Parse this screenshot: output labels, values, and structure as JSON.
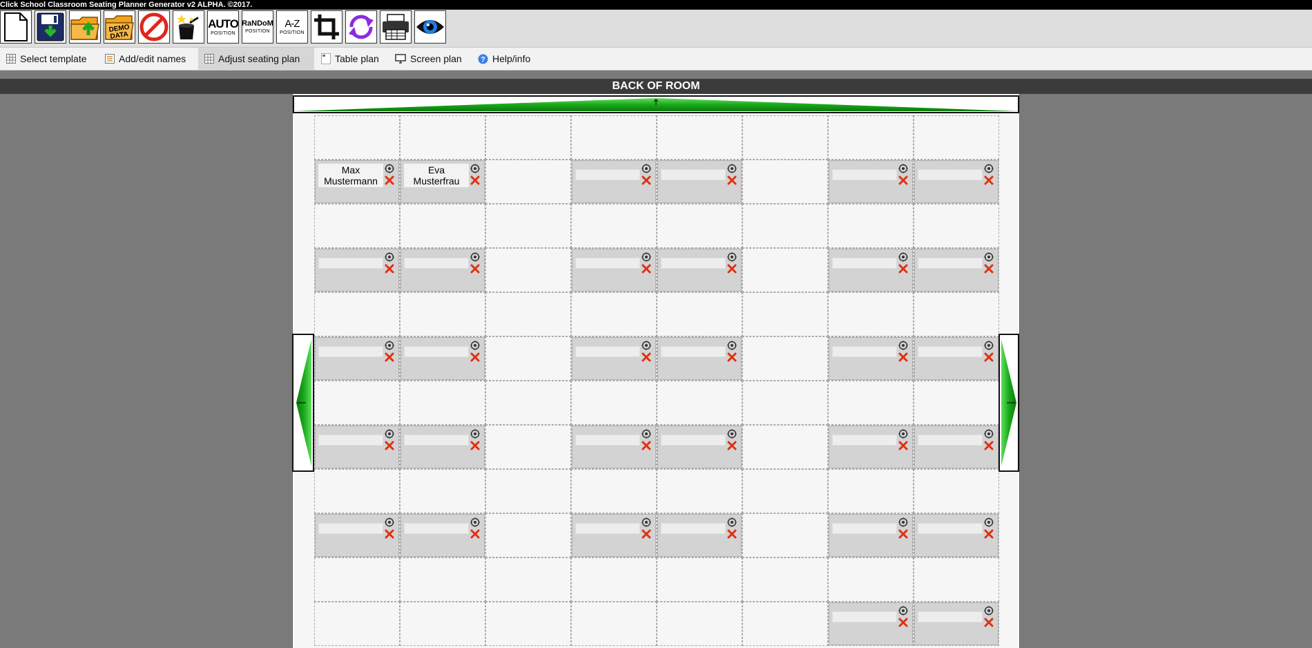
{
  "window": {
    "title": "Click School Classroom Seating Planner Generator v2 ALPHA. ©2017."
  },
  "toolbar": {
    "buttons": [
      {
        "id": "new",
        "icon": "new-document-icon"
      },
      {
        "id": "save",
        "icon": "save-disk-icon"
      },
      {
        "id": "open",
        "icon": "open-folder-icon"
      },
      {
        "id": "demo",
        "icon": "demo-data-folder-icon",
        "label": "DEMO DATA"
      },
      {
        "id": "clear",
        "icon": "no-entry-icon"
      },
      {
        "id": "magic",
        "icon": "magic-wand-icon"
      },
      {
        "id": "auto",
        "label_big": "AUTO",
        "label_small": "POSITION"
      },
      {
        "id": "random",
        "label_big": "RaNDoM",
        "label_small": "POSITION"
      },
      {
        "id": "az",
        "label_big": "A-Z",
        "label_small": "POSITION"
      },
      {
        "id": "crop",
        "icon": "crop-icon"
      },
      {
        "id": "refresh",
        "icon": "refresh-icon"
      },
      {
        "id": "print",
        "icon": "printer-icon"
      },
      {
        "id": "view",
        "icon": "eye-icon"
      }
    ]
  },
  "tabs": [
    {
      "label": "Select template",
      "icon": "grid-icon"
    },
    {
      "label": "Add/edit names",
      "icon": "list-icon"
    },
    {
      "label": "Adjust seating plan",
      "icon": "grid-icon",
      "active": true
    },
    {
      "label": "Table plan",
      "icon": "table-plan-icon"
    },
    {
      "label": "Screen plan",
      "icon": "monitor-icon"
    },
    {
      "label": "Help/info",
      "icon": "help-icon"
    }
  ],
  "room": {
    "back_label": "BACK OF ROOM"
  },
  "desks": [
    {
      "row": 1,
      "col": 0,
      "name": "Max Mustermann"
    },
    {
      "row": 1,
      "col": 1,
      "name": "Eva Musterfrau"
    },
    {
      "row": 1,
      "col": 3,
      "name": ""
    },
    {
      "row": 1,
      "col": 4,
      "name": ""
    },
    {
      "row": 1,
      "col": 6,
      "name": ""
    },
    {
      "row": 1,
      "col": 7,
      "name": ""
    },
    {
      "row": 3,
      "col": 0,
      "name": ""
    },
    {
      "row": 3,
      "col": 1,
      "name": ""
    },
    {
      "row": 3,
      "col": 3,
      "name": ""
    },
    {
      "row": 3,
      "col": 4,
      "name": ""
    },
    {
      "row": 3,
      "col": 6,
      "name": ""
    },
    {
      "row": 3,
      "col": 7,
      "name": ""
    },
    {
      "row": 5,
      "col": 0,
      "name": ""
    },
    {
      "row": 5,
      "col": 1,
      "name": ""
    },
    {
      "row": 5,
      "col": 3,
      "name": ""
    },
    {
      "row": 5,
      "col": 4,
      "name": ""
    },
    {
      "row": 5,
      "col": 6,
      "name": ""
    },
    {
      "row": 5,
      "col": 7,
      "name": ""
    },
    {
      "row": 7,
      "col": 0,
      "name": ""
    },
    {
      "row": 7,
      "col": 1,
      "name": ""
    },
    {
      "row": 7,
      "col": 3,
      "name": ""
    },
    {
      "row": 7,
      "col": 4,
      "name": ""
    },
    {
      "row": 7,
      "col": 6,
      "name": ""
    },
    {
      "row": 7,
      "col": 7,
      "name": ""
    },
    {
      "row": 9,
      "col": 0,
      "name": ""
    },
    {
      "row": 9,
      "col": 1,
      "name": ""
    },
    {
      "row": 9,
      "col": 3,
      "name": ""
    },
    {
      "row": 9,
      "col": 4,
      "name": ""
    },
    {
      "row": 9,
      "col": 6,
      "name": ""
    },
    {
      "row": 9,
      "col": 7,
      "name": ""
    },
    {
      "row": 11,
      "col": 6,
      "name": ""
    },
    {
      "row": 11,
      "col": 7,
      "name": ""
    }
  ],
  "colors": {
    "arrow_green": "#22b422",
    "close_red": "#e03010",
    "desk_gray": "#d3d3d3"
  }
}
